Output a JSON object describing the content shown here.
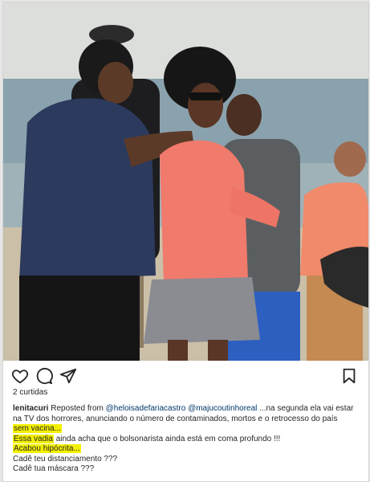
{
  "post": {
    "likes_text": "2 curtidas",
    "username": "lenitacuri",
    "repost_prefix": "Reposted from",
    "mention_1": "@heloisadefariacastro",
    "mention_2": "@majucoutinhoreal",
    "caption_line1_rest": "...na segunda ela vai estar",
    "caption_line2": "na TV dos horrores, anunciando o número de contaminados, mortos e o retrocesso do país",
    "caption_line3": "sem vacina...",
    "caption_line4_hl": "Essa vadia",
    "caption_line4_rest": "ainda acha que o bolsonarista ainda está em coma profundo !!!",
    "caption_line5": "Acabou hipócrita...",
    "caption_line6": "Cadê teu distanciamento ???",
    "caption_line7": "Cadê tua máscara ???"
  },
  "icons": {
    "like": "heart-icon",
    "comment": "comment-icon",
    "share": "send-icon",
    "save": "bookmark-icon"
  },
  "colors": {
    "highlight": "#f3f000",
    "mention": "#00376b",
    "text": "#262626"
  }
}
